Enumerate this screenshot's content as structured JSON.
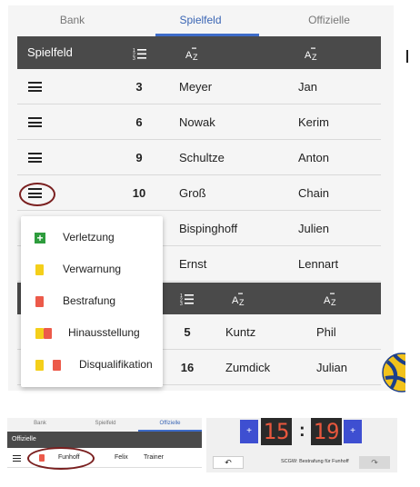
{
  "tabs": [
    "Bank",
    "Spielfeld",
    "Offizielle"
  ],
  "header": {
    "title": "Spielfeld",
    "icons": [
      "number-list-icon",
      "sort-az-icon",
      "sort-az-icon"
    ],
    "number_sym": "☰",
    "az_sym": "AZ"
  },
  "players": [
    {
      "number": "3",
      "last": "Meyer",
      "first": "Jan"
    },
    {
      "number": "6",
      "last": "Nowak",
      "first": "Kerim"
    },
    {
      "number": "9",
      "last": "Schultze",
      "first": "Anton"
    },
    {
      "number": "10",
      "last": "Groß",
      "first": "Chain"
    },
    {
      "number": "",
      "last": "Bispinghoff",
      "first": "Julien"
    },
    {
      "number": "",
      "last": "Ernst",
      "first": "Lennart"
    }
  ],
  "players2": [
    {
      "number": "5",
      "last": "Kuntz",
      "first": "Phil"
    },
    {
      "number": "16",
      "last": "Zumdick",
      "first": "Julian"
    }
  ],
  "popup_menu": [
    {
      "label": "Verletzung",
      "icon": "plus-icon"
    },
    {
      "label": "Verwarnung",
      "icon": "yellow-card-icon"
    },
    {
      "label": "Bestrafung",
      "icon": "red-card-icon"
    },
    {
      "label": "Hinausstellung",
      "icon": "yellow-red-card-icon"
    },
    {
      "label": "Disqualifikation",
      "icon": "yellow-red-card-icon"
    }
  ],
  "bottom": {
    "tabs": [
      "Bank",
      "Spielfeld",
      "Offizielle"
    ],
    "header_title": "Offizielle",
    "official": {
      "last": "Funhoff",
      "first": "Felix",
      "role": "Trainer"
    },
    "score": {
      "left": "15",
      "right": "19",
      "colon": ":"
    },
    "plus_label": "+",
    "status": "SCGW: Bestrafung für Funhoff",
    "undo_sym": "↶",
    "redo_sym": "↷"
  },
  "colors": {
    "accent": "#3e6cc9",
    "header": "#4a4a4a",
    "highlight": "#7a1f1f",
    "yellow_card": "#f4cf1a",
    "red_card": "#ec5a4a",
    "green": "#2e9c3d",
    "score_digits": "#e8573d"
  }
}
